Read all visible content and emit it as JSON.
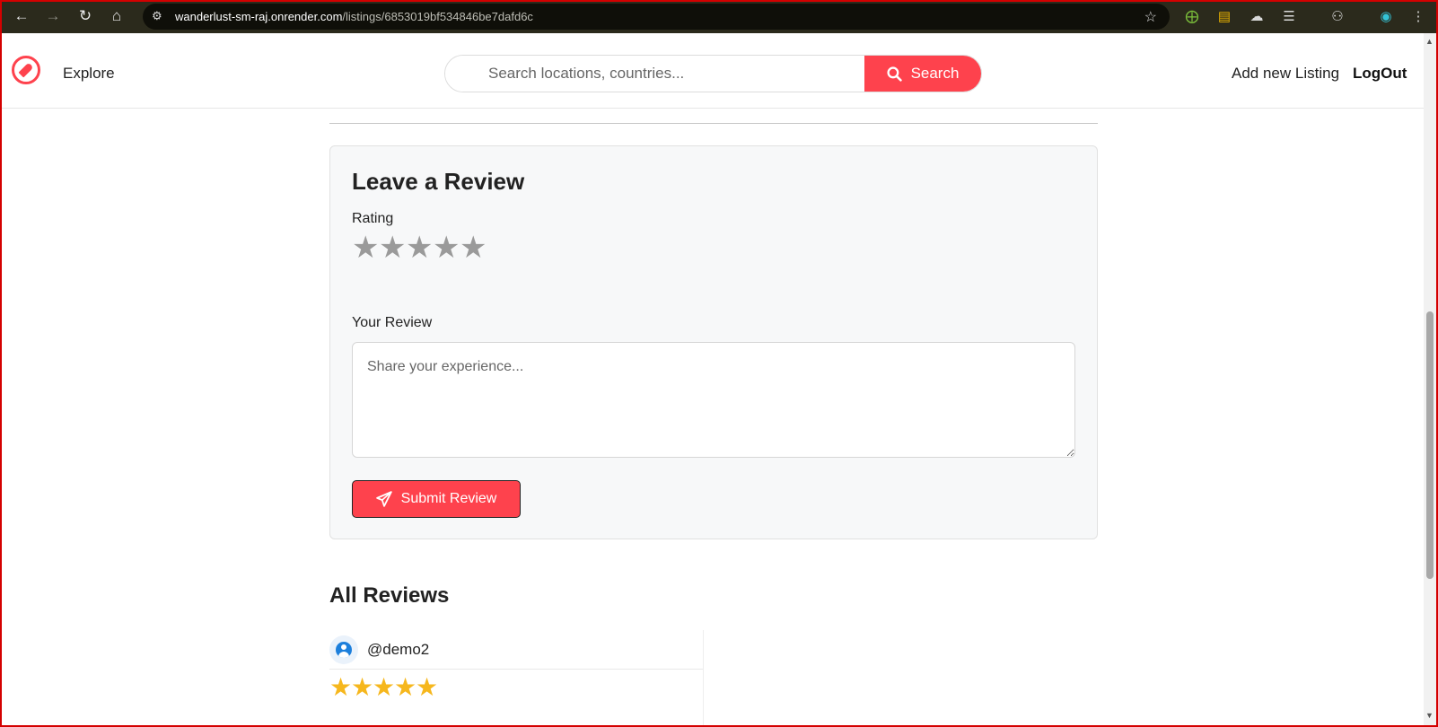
{
  "browser": {
    "url_host": "wanderlust-sm-raj.onrender.com",
    "url_path": "/listings/6853019bf534846be7dafd6c"
  },
  "navbar": {
    "explore": "Explore",
    "search_placeholder": "Search locations, countries...",
    "search_button": "Search",
    "add_listing": "Add new Listing",
    "logout": "LogOut"
  },
  "review_form": {
    "title": "Leave a Review",
    "rating_label": "Rating",
    "rating_value": 0,
    "rating_max": 5,
    "review_label": "Your Review",
    "review_placeholder": "Share your experience...",
    "review_value": "",
    "submit_label": "Submit Review"
  },
  "reviews": {
    "heading": "All Reviews",
    "items": [
      {
        "username": "@demo2",
        "rating": 5
      }
    ]
  },
  "colors": {
    "brand": "#fe424d",
    "star_empty": "#9a9a9a",
    "star_filled": "#f6b71d"
  }
}
